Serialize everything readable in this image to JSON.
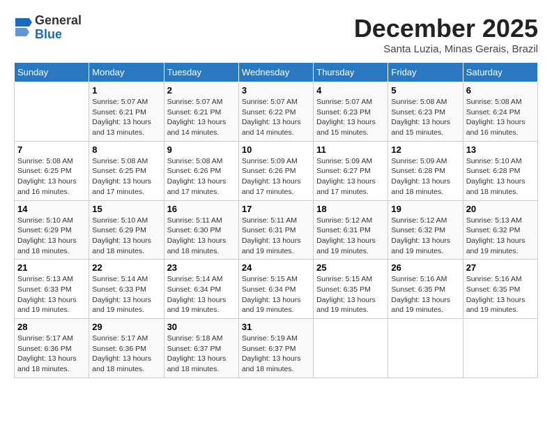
{
  "header": {
    "logo_general": "General",
    "logo_blue": "Blue",
    "month": "December 2025",
    "location": "Santa Luzia, Minas Gerais, Brazil"
  },
  "days_of_week": [
    "Sunday",
    "Monday",
    "Tuesday",
    "Wednesday",
    "Thursday",
    "Friday",
    "Saturday"
  ],
  "weeks": [
    [
      {
        "day": "",
        "sunrise": "",
        "sunset": "",
        "daylight": ""
      },
      {
        "day": "1",
        "sunrise": "Sunrise: 5:07 AM",
        "sunset": "Sunset: 6:21 PM",
        "daylight": "Daylight: 13 hours and 13 minutes."
      },
      {
        "day": "2",
        "sunrise": "Sunrise: 5:07 AM",
        "sunset": "Sunset: 6:21 PM",
        "daylight": "Daylight: 13 hours and 14 minutes."
      },
      {
        "day": "3",
        "sunrise": "Sunrise: 5:07 AM",
        "sunset": "Sunset: 6:22 PM",
        "daylight": "Daylight: 13 hours and 14 minutes."
      },
      {
        "day": "4",
        "sunrise": "Sunrise: 5:07 AM",
        "sunset": "Sunset: 6:23 PM",
        "daylight": "Daylight: 13 hours and 15 minutes."
      },
      {
        "day": "5",
        "sunrise": "Sunrise: 5:08 AM",
        "sunset": "Sunset: 6:23 PM",
        "daylight": "Daylight: 13 hours and 15 minutes."
      },
      {
        "day": "6",
        "sunrise": "Sunrise: 5:08 AM",
        "sunset": "Sunset: 6:24 PM",
        "daylight": "Daylight: 13 hours and 16 minutes."
      }
    ],
    [
      {
        "day": "7",
        "sunrise": "Sunrise: 5:08 AM",
        "sunset": "Sunset: 6:25 PM",
        "daylight": "Daylight: 13 hours and 16 minutes."
      },
      {
        "day": "8",
        "sunrise": "Sunrise: 5:08 AM",
        "sunset": "Sunset: 6:25 PM",
        "daylight": "Daylight: 13 hours and 17 minutes."
      },
      {
        "day": "9",
        "sunrise": "Sunrise: 5:08 AM",
        "sunset": "Sunset: 6:26 PM",
        "daylight": "Daylight: 13 hours and 17 minutes."
      },
      {
        "day": "10",
        "sunrise": "Sunrise: 5:09 AM",
        "sunset": "Sunset: 6:26 PM",
        "daylight": "Daylight: 13 hours and 17 minutes."
      },
      {
        "day": "11",
        "sunrise": "Sunrise: 5:09 AM",
        "sunset": "Sunset: 6:27 PM",
        "daylight": "Daylight: 13 hours and 17 minutes."
      },
      {
        "day": "12",
        "sunrise": "Sunrise: 5:09 AM",
        "sunset": "Sunset: 6:28 PM",
        "daylight": "Daylight: 13 hours and 18 minutes."
      },
      {
        "day": "13",
        "sunrise": "Sunrise: 5:10 AM",
        "sunset": "Sunset: 6:28 PM",
        "daylight": "Daylight: 13 hours and 18 minutes."
      }
    ],
    [
      {
        "day": "14",
        "sunrise": "Sunrise: 5:10 AM",
        "sunset": "Sunset: 6:29 PM",
        "daylight": "Daylight: 13 hours and 18 minutes."
      },
      {
        "day": "15",
        "sunrise": "Sunrise: 5:10 AM",
        "sunset": "Sunset: 6:29 PM",
        "daylight": "Daylight: 13 hours and 18 minutes."
      },
      {
        "day": "16",
        "sunrise": "Sunrise: 5:11 AM",
        "sunset": "Sunset: 6:30 PM",
        "daylight": "Daylight: 13 hours and 18 minutes."
      },
      {
        "day": "17",
        "sunrise": "Sunrise: 5:11 AM",
        "sunset": "Sunset: 6:31 PM",
        "daylight": "Daylight: 13 hours and 19 minutes."
      },
      {
        "day": "18",
        "sunrise": "Sunrise: 5:12 AM",
        "sunset": "Sunset: 6:31 PM",
        "daylight": "Daylight: 13 hours and 19 minutes."
      },
      {
        "day": "19",
        "sunrise": "Sunrise: 5:12 AM",
        "sunset": "Sunset: 6:32 PM",
        "daylight": "Daylight: 13 hours and 19 minutes."
      },
      {
        "day": "20",
        "sunrise": "Sunrise: 5:13 AM",
        "sunset": "Sunset: 6:32 PM",
        "daylight": "Daylight: 13 hours and 19 minutes."
      }
    ],
    [
      {
        "day": "21",
        "sunrise": "Sunrise: 5:13 AM",
        "sunset": "Sunset: 6:33 PM",
        "daylight": "Daylight: 13 hours and 19 minutes."
      },
      {
        "day": "22",
        "sunrise": "Sunrise: 5:14 AM",
        "sunset": "Sunset: 6:33 PM",
        "daylight": "Daylight: 13 hours and 19 minutes."
      },
      {
        "day": "23",
        "sunrise": "Sunrise: 5:14 AM",
        "sunset": "Sunset: 6:34 PM",
        "daylight": "Daylight: 13 hours and 19 minutes."
      },
      {
        "day": "24",
        "sunrise": "Sunrise: 5:15 AM",
        "sunset": "Sunset: 6:34 PM",
        "daylight": "Daylight: 13 hours and 19 minutes."
      },
      {
        "day": "25",
        "sunrise": "Sunrise: 5:15 AM",
        "sunset": "Sunset: 6:35 PM",
        "daylight": "Daylight: 13 hours and 19 minutes."
      },
      {
        "day": "26",
        "sunrise": "Sunrise: 5:16 AM",
        "sunset": "Sunset: 6:35 PM",
        "daylight": "Daylight: 13 hours and 19 minutes."
      },
      {
        "day": "27",
        "sunrise": "Sunrise: 5:16 AM",
        "sunset": "Sunset: 6:35 PM",
        "daylight": "Daylight: 13 hours and 19 minutes."
      }
    ],
    [
      {
        "day": "28",
        "sunrise": "Sunrise: 5:17 AM",
        "sunset": "Sunset: 6:36 PM",
        "daylight": "Daylight: 13 hours and 18 minutes."
      },
      {
        "day": "29",
        "sunrise": "Sunrise: 5:17 AM",
        "sunset": "Sunset: 6:36 PM",
        "daylight": "Daylight: 13 hours and 18 minutes."
      },
      {
        "day": "30",
        "sunrise": "Sunrise: 5:18 AM",
        "sunset": "Sunset: 6:37 PM",
        "daylight": "Daylight: 13 hours and 18 minutes."
      },
      {
        "day": "31",
        "sunrise": "Sunrise: 5:19 AM",
        "sunset": "Sunset: 6:37 PM",
        "daylight": "Daylight: 13 hours and 18 minutes."
      },
      {
        "day": "",
        "sunrise": "",
        "sunset": "",
        "daylight": ""
      },
      {
        "day": "",
        "sunrise": "",
        "sunset": "",
        "daylight": ""
      },
      {
        "day": "",
        "sunrise": "",
        "sunset": "",
        "daylight": ""
      }
    ]
  ]
}
